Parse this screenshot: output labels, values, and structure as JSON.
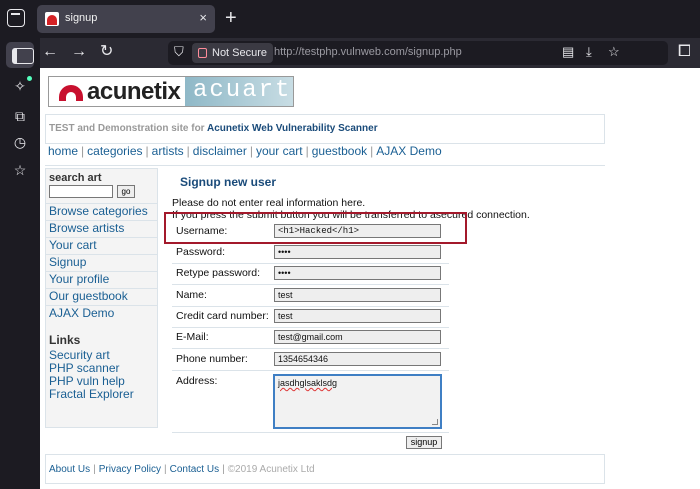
{
  "browser": {
    "tab_title": "signup",
    "tab_close": "×",
    "new_tab": "+",
    "back": "←",
    "forward": "→",
    "reload": "↻",
    "not_secure": "Not Secure",
    "url": "http://testphp.vulnweb.com/signup.php"
  },
  "site": {
    "logo_left": "acunetix",
    "logo_right": "acuart",
    "tagline_prefix": "TEST and Demonstration site for",
    "tagline_link": "Acunetix Web Vulnerability Scanner",
    "topnav": [
      "home",
      "categories",
      "artists",
      "disclaimer",
      "your cart",
      "guestbook",
      "AJAX Demo"
    ],
    "nav_separator": "|"
  },
  "left": {
    "search_title": "search art",
    "go_label": "go",
    "menu": [
      "Browse categories",
      "Browse artists",
      "Your cart",
      "Signup",
      "Your profile",
      "Our guestbook",
      "AJAX Demo"
    ],
    "links_title": "Links",
    "links": [
      "Security art",
      "PHP scanner",
      "PHP vuln help",
      "Fractal Explorer"
    ]
  },
  "main": {
    "title": "Signup new user",
    "note_line1": "Please do not enter real information here.",
    "note_line2": "If you press the submit button you will be transferred to asecured connection.",
    "fields": [
      {
        "label": "Username:",
        "value": "<h1>Hacked</h1>"
      },
      {
        "label": "Password:",
        "value": "••••"
      },
      {
        "label": "Retype password:",
        "value": "••••"
      },
      {
        "label": "Name:",
        "value": "test"
      },
      {
        "label": "Credit card number:",
        "value": "test"
      },
      {
        "label": "E-Mail:",
        "value": "test@gmail.com"
      },
      {
        "label": "Phone number:",
        "value": "1354654346"
      }
    ],
    "address_label": "Address:",
    "address_value": "jasdhglsaklsdg",
    "submit_label": "signup"
  },
  "footer": {
    "links": [
      "About Us",
      "Privacy Policy",
      "Contact Us"
    ],
    "copyright": "©2019 Acunetix Ltd"
  },
  "colors": {
    "highlight_border": "#a3192b",
    "link_blue": "#1a5f93",
    "focus_blue": "#3f7fc4"
  }
}
